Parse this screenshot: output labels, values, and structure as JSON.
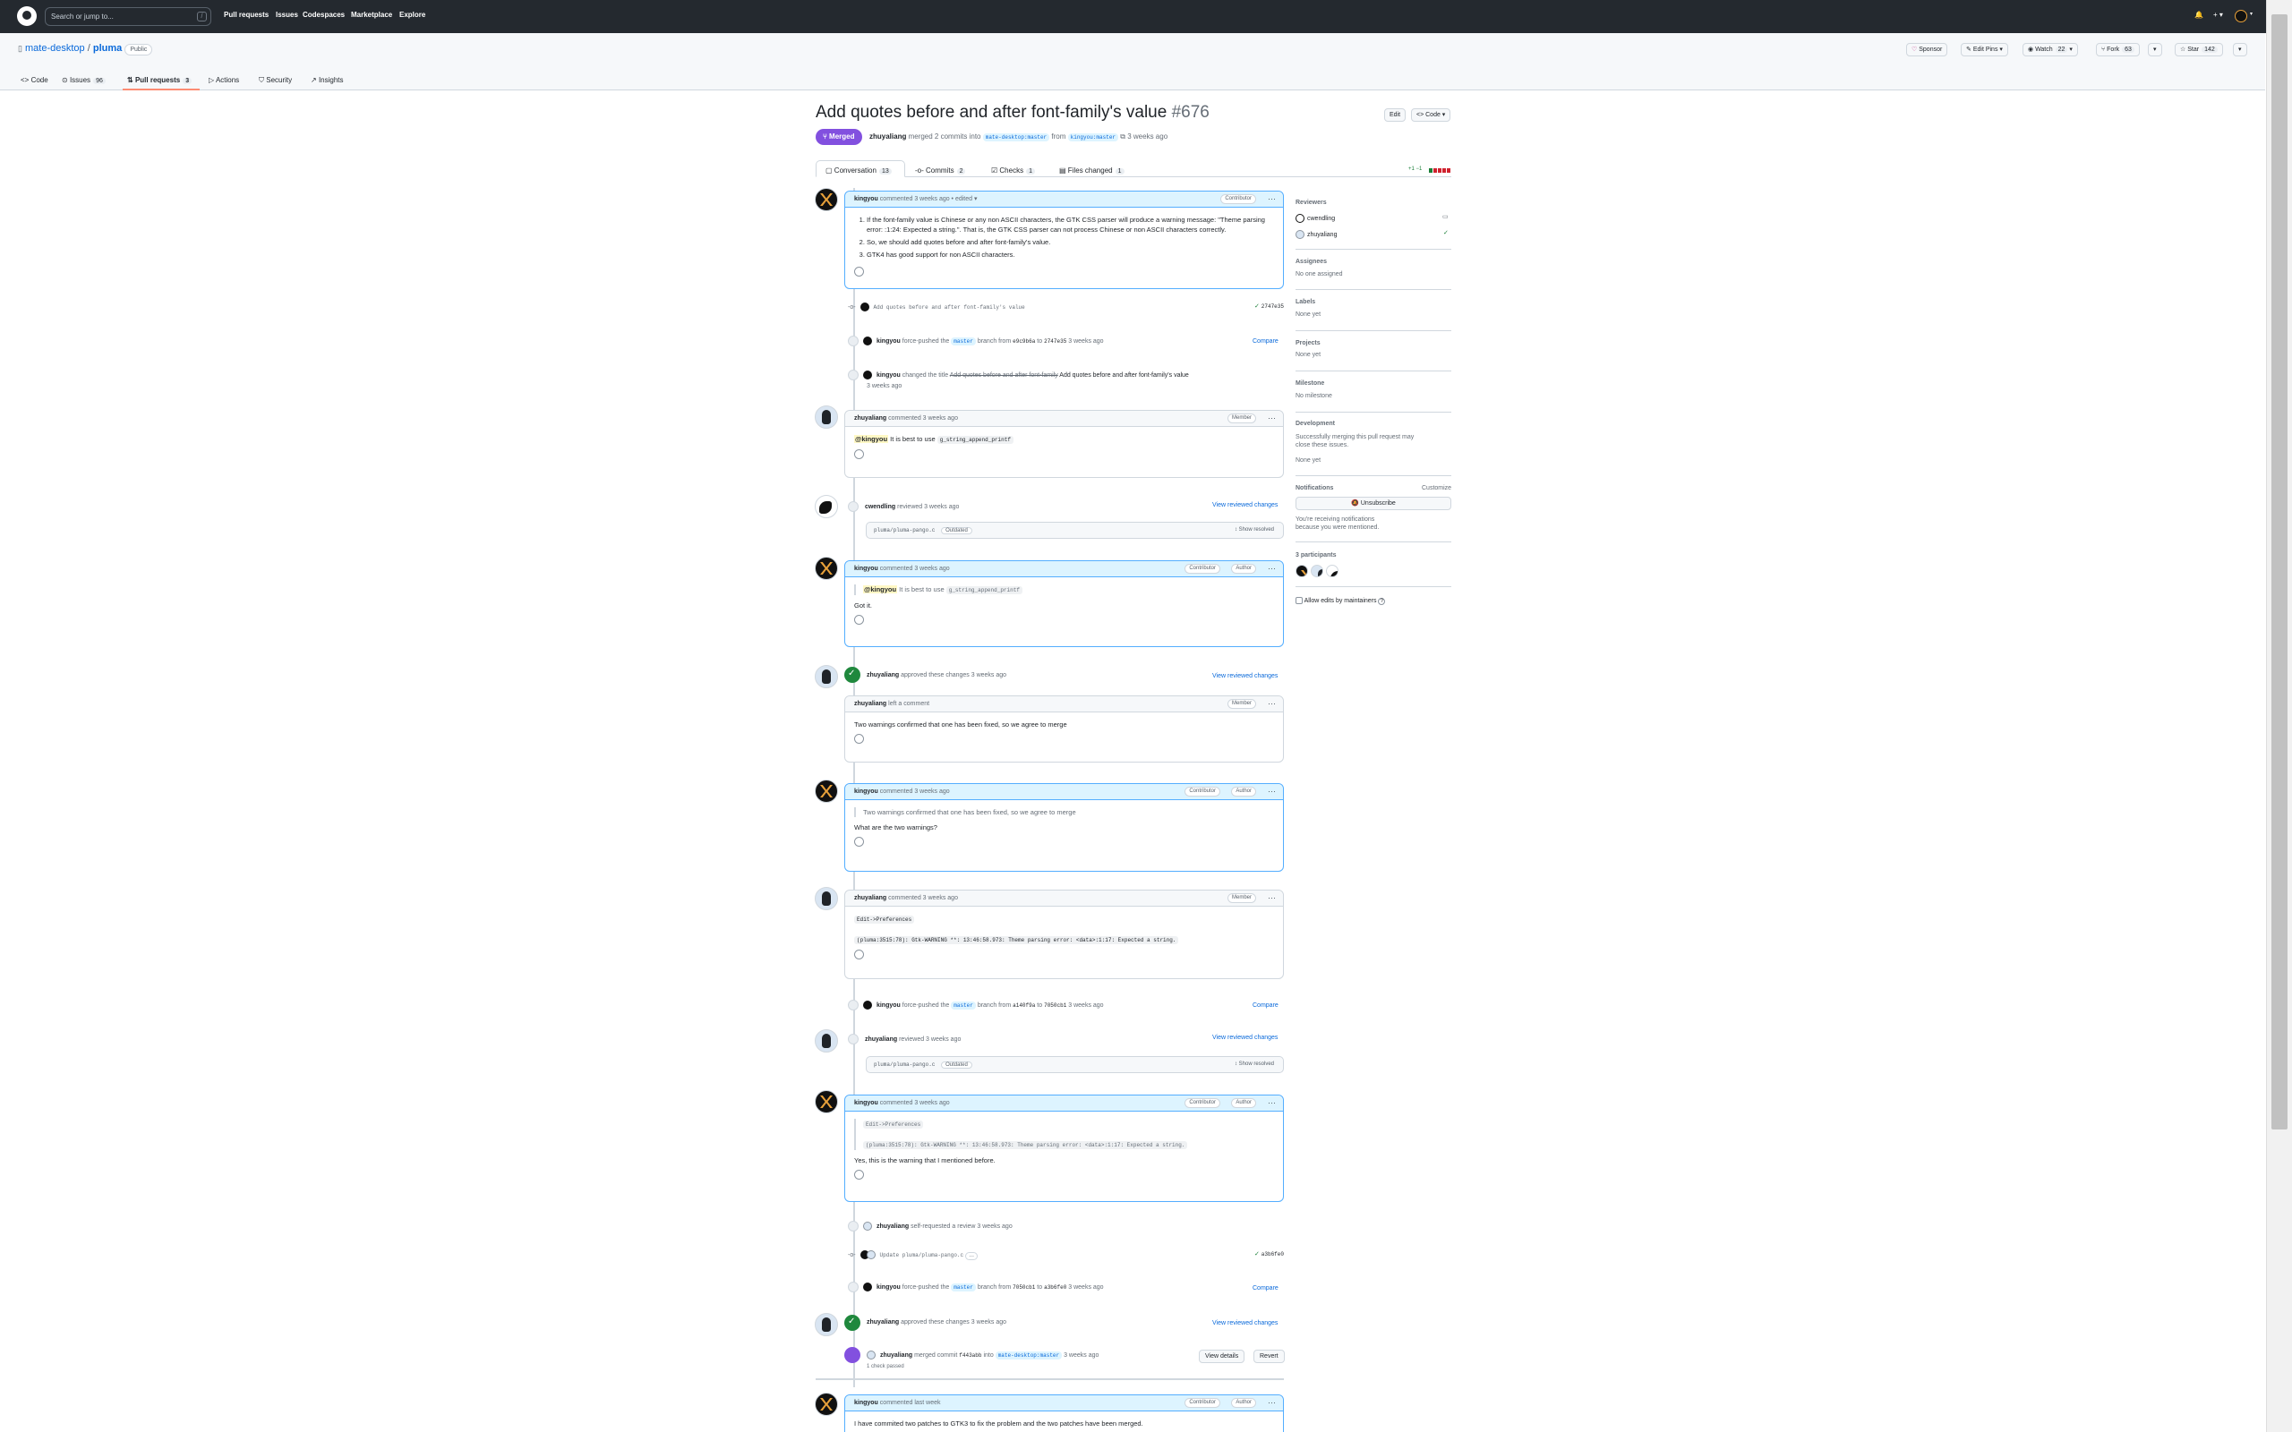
{
  "header": {
    "search_placeholder": "Search or jump to...",
    "search_key": "/",
    "nav": [
      "Pull requests",
      "Issues",
      "Codespaces",
      "Marketplace",
      "Explore"
    ]
  },
  "repo": {
    "owner": "mate-desktop",
    "sep": "/",
    "name": "pluma",
    "visibility": "Public",
    "sponsor": "Sponsor",
    "edit_pins": "Edit Pins",
    "watch": "Watch",
    "watch_count": "22",
    "fork": "Fork",
    "fork_count": "63",
    "star": "Star",
    "star_count": "142",
    "tabs": [
      {
        "label": "Code",
        "count": ""
      },
      {
        "label": "Issues",
        "count": "96"
      },
      {
        "label": "Pull requests",
        "count": "3"
      },
      {
        "label": "Actions",
        "count": ""
      },
      {
        "label": "Security",
        "count": ""
      },
      {
        "label": "Insights",
        "count": ""
      }
    ]
  },
  "pr": {
    "title": "Add quotes before and after font-family's value",
    "number": "#676",
    "edit": "Edit",
    "code": "<> Code",
    "status": "Merged",
    "meta_user": "zhuyaliang",
    "meta_text": "merged 2 commits into",
    "base_branch": "mate-desktop:master",
    "meta_from": "from",
    "head_branch": "kingyou:master",
    "meta_time": "3 weeks ago",
    "tabs": [
      {
        "label": "Conversation",
        "count": "13"
      },
      {
        "label": "Commits",
        "count": "2"
      },
      {
        "label": "Checks",
        "count": "1"
      },
      {
        "label": "Files changed",
        "count": "1"
      }
    ],
    "diff": "+1 −1"
  },
  "timeline": {
    "c1": {
      "user": "kingyou",
      "action": "commented 3 weeks ago • edited",
      "role": "Contributor",
      "items": [
        "If the font-family value is Chinese or any non ASCII characters, the GTK CSS parser will produce a warning message: \"Theme parsing error: :1:24: Expected a string.\". That is, the GTK CSS parser can not process Chinese or non ASCII characters correctly.",
        "So, we should add quotes before and after font-family's value.",
        "GTK4 has good support for non ASCII characters."
      ]
    },
    "commit1": {
      "message": "Add quotes before and after font-family's value",
      "sha": "2747e35"
    },
    "force1": {
      "user": "kingyou",
      "text1": "force-pushed the",
      "branch": "master",
      "text2": "branch from",
      "from": "e9c9b6a",
      "to_text": "to",
      "to": "2747e35",
      "time": "3 weeks ago",
      "link": "Compare"
    },
    "rename": {
      "user": "kingyou",
      "text": "changed the title",
      "old": "Add quotes before and after font-family",
      "new": "Add quotes before and after font-family's value",
      "time": "3 weeks ago"
    },
    "c2": {
      "user": "zhuyaliang",
      "action": "commented 3 weeks ago",
      "role": "Member",
      "mention": "@kingyou",
      "text": "It is best to use",
      "code": "g_string_append_printf"
    },
    "review1": {
      "user": "cwendling",
      "action": "reviewed 3 weeks ago",
      "link": "View reviewed changes",
      "file": "pluma/pluma-pango.c",
      "tag": "Outdated",
      "show": "Show resolved"
    },
    "c3": {
      "user": "kingyou",
      "action": "commented 3 weeks ago",
      "role1": "Contributor",
      "role2": "Author",
      "q_mention": "@kingyou",
      "q_text": "It is best to use",
      "q_code": "g_string_append_printf",
      "text": "Got it."
    },
    "approve1": {
      "user": "zhuyaliang",
      "action": "approved these changes 3 weeks ago",
      "link": "View reviewed changes"
    },
    "c4": {
      "user": "zhuyaliang",
      "action": "left a comment",
      "role": "Member",
      "text": "Two warnings confirmed that one has been fixed, so we agree to merge"
    },
    "c5": {
      "user": "kingyou",
      "action": "commented 3 weeks ago",
      "role1": "Contributor",
      "role2": "Author",
      "quote": "Two warnings confirmed that one has been fixed, so we agree to merge",
      "text": "What are the two warnings?"
    },
    "c6": {
      "user": "zhuyaliang",
      "action": "commented 3 weeks ago",
      "role": "Member",
      "code1": "Edit->Preferences",
      "code2": "(pluma:3515:78): Gtk-WARNING **: 13:46:58.973: Theme parsing error: <data>:1:17: Expected a string."
    },
    "force2": {
      "user": "kingyou",
      "text1": "force-pushed the",
      "branch": "master",
      "text2": "branch from",
      "from": "a140f9a",
      "to_text": "to",
      "to": "7050cb1",
      "time": "3 weeks ago",
      "link": "Compare"
    },
    "review2": {
      "user": "zhuyaliang",
      "action": "reviewed 3 weeks ago",
      "link": "View reviewed changes",
      "file": "pluma/pluma-pango.c",
      "tag": "Outdated",
      "show": "Show resolved"
    },
    "c7": {
      "user": "kingyou",
      "action": "commented 3 weeks ago",
      "role1": "Contributor",
      "role2": "Author",
      "q_code1": "Edit->Preferences",
      "q_code2": "(pluma:3515:78): Gtk-WARNING **: 13:46:58.973: Theme parsing error: <data>:1:17: Expected a string.",
      "text": "Yes, this is the warning that I mentioned before."
    },
    "selfreq": {
      "user": "zhuyaliang",
      "text": "self-requested a review 3 weeks ago"
    },
    "commit2": {
      "message": "Update pluma/pluma-pango.c",
      "more": "…",
      "sha": "a3b6fe0"
    },
    "force3": {
      "user": "kingyou",
      "text1": "force-pushed the",
      "branch": "master",
      "text2": "branch from",
      "from": "7050cb1",
      "to_text": "to",
      "to": "a3b6fe0",
      "time": "3 weeks ago",
      "link": "Compare"
    },
    "approve2": {
      "user": "zhuyaliang",
      "action": "approved these changes 3 weeks ago",
      "link": "View reviewed changes"
    },
    "merge": {
      "user": "zhuyaliang",
      "text1": "merged commit",
      "sha": "f443abb",
      "text2": "into",
      "branch": "mate-desktop:master",
      "time": "3 weeks ago",
      "checks": "1 check passed",
      "details": "View details",
      "revert": "Revert"
    },
    "c8": {
      "user": "kingyou",
      "action": "commented last week",
      "role1": "Contributor",
      "role2": "Author",
      "text": "I have commited two patches to GTK3 to fix the problem and the two patches have been merged."
    }
  },
  "sidebar": {
    "reviewers_title": "Reviewers",
    "reviewers": [
      "cwendling",
      "zhuyaliang"
    ],
    "assignees_title": "Assignees",
    "assignees_val": "No one assigned",
    "labels_title": "Labels",
    "labels_val": "None yet",
    "projects_title": "Projects",
    "projects_val": "None yet",
    "milestone_title": "Milestone",
    "milestone_val": "No milestone",
    "dev_title": "Development",
    "dev_text": "Successfully merging this pull request may close these issues.",
    "dev_val": "None yet",
    "notif_title": "Notifications",
    "notif_customize": "Customize",
    "unsubscribe": "Unsubscribe",
    "notif_reason": "You're receiving notifications because you were mentioned.",
    "participants_title": "3 participants",
    "allow_edits": "Allow edits by maintainers"
  }
}
